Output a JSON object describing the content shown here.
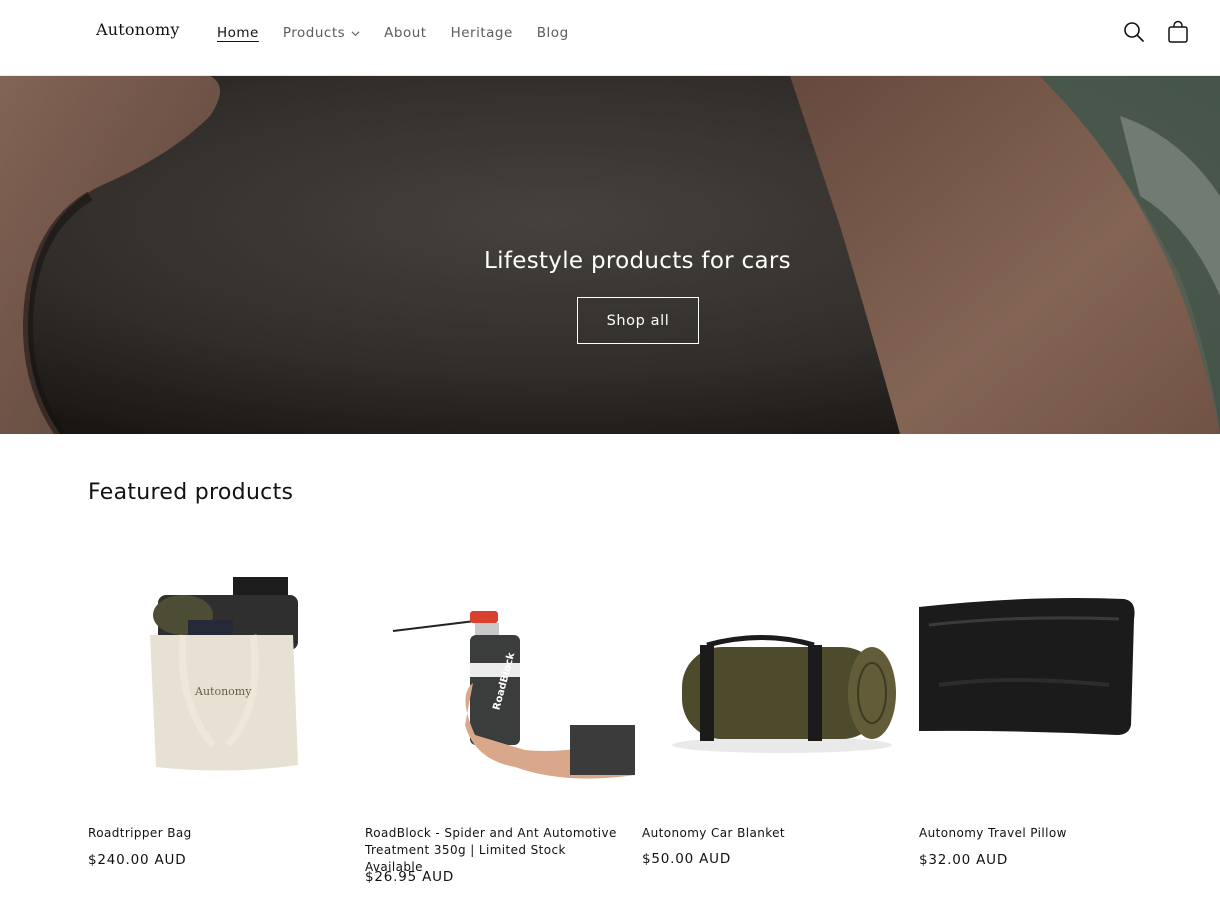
{
  "header": {
    "logo": "Autonomy",
    "nav": [
      {
        "label": "Home",
        "active": true
      },
      {
        "label": "Products",
        "has_dropdown": true
      },
      {
        "label": "About"
      },
      {
        "label": "Heritage"
      },
      {
        "label": "Blog"
      }
    ],
    "icons": [
      "search-icon",
      "cart-icon"
    ]
  },
  "hero": {
    "title": "Lifestyle products for cars",
    "button_label": "Shop all"
  },
  "featured": {
    "title": "Featured products",
    "products": [
      {
        "title": "Roadtripper Bag",
        "price": "$240.00 AUD",
        "image": "tote-bag-image"
      },
      {
        "title": "RoadBlock - Spider and Ant Automotive Treatment 350g | Limited Stock Available",
        "price": "$26.95 AUD",
        "image": "spray-can-image"
      },
      {
        "title": "Autonomy Car Blanket",
        "price": "$50.00 AUD",
        "image": "rolled-blanket-image"
      },
      {
        "title": "Autonomy Travel Pillow",
        "price": "$32.00 AUD",
        "image": "leather-pillow-image"
      }
    ]
  },
  "colors": {
    "text": "#121212",
    "nav_muted": "#5c5c5c",
    "hero_overlay": "#2b2623"
  }
}
